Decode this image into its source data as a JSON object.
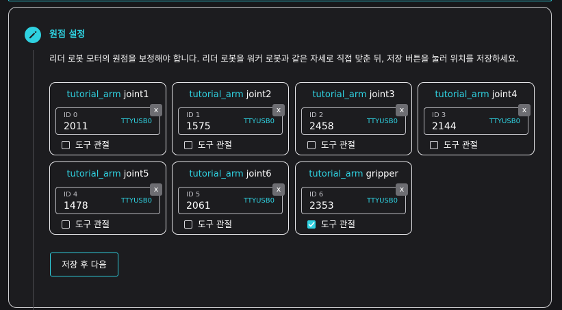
{
  "section": {
    "title": "원점 설정",
    "description": "리더 로봇 모터의 원점을 보정해야 합니다. 리더 로봇을 워커 로봇과 같은 자세로 직접 맞춘 뒤, 저장 버튼을 눌러 위치를 저장하세요."
  },
  "cards": [
    {
      "robot": "tutorial_arm",
      "joint": "joint1",
      "id_label": "ID 0",
      "value": "2011",
      "port": "TTYUSB0",
      "close": "x",
      "tool_label": "도구 관절",
      "tool_checked": false
    },
    {
      "robot": "tutorial_arm",
      "joint": "joint2",
      "id_label": "ID 1",
      "value": "1575",
      "port": "TTYUSB0",
      "close": "x",
      "tool_label": "도구 관절",
      "tool_checked": false
    },
    {
      "robot": "tutorial_arm",
      "joint": "joint3",
      "id_label": "ID 2",
      "value": "2458",
      "port": "TTYUSB0",
      "close": "x",
      "tool_label": "도구 관절",
      "tool_checked": false
    },
    {
      "robot": "tutorial_arm",
      "joint": "joint4",
      "id_label": "ID 3",
      "value": "2144",
      "port": "TTYUSB0",
      "close": "x",
      "tool_label": "도구 관절",
      "tool_checked": false
    },
    {
      "robot": "tutorial_arm",
      "joint": "joint5",
      "id_label": "ID 4",
      "value": "1478",
      "port": "TTYUSB0",
      "close": "x",
      "tool_label": "도구 관절",
      "tool_checked": false
    },
    {
      "robot": "tutorial_arm",
      "joint": "joint6",
      "id_label": "ID 5",
      "value": "2061",
      "port": "TTYUSB0",
      "close": "x",
      "tool_label": "도구 관절",
      "tool_checked": false
    },
    {
      "robot": "tutorial_arm",
      "joint": "gripper",
      "id_label": "ID 6",
      "value": "2353",
      "port": "TTYUSB0",
      "close": "x",
      "tool_label": "도구 관절",
      "tool_checked": true
    }
  ],
  "actions": {
    "save_next_label": "저장 후 다음"
  },
  "icons": {
    "step": "pencil-icon",
    "close": "close-icon",
    "check": "checkmark-icon"
  },
  "colors": {
    "accent": "#2fd1e0",
    "background": "#1c1c1f",
    "card_border": "#e6e6e9"
  }
}
